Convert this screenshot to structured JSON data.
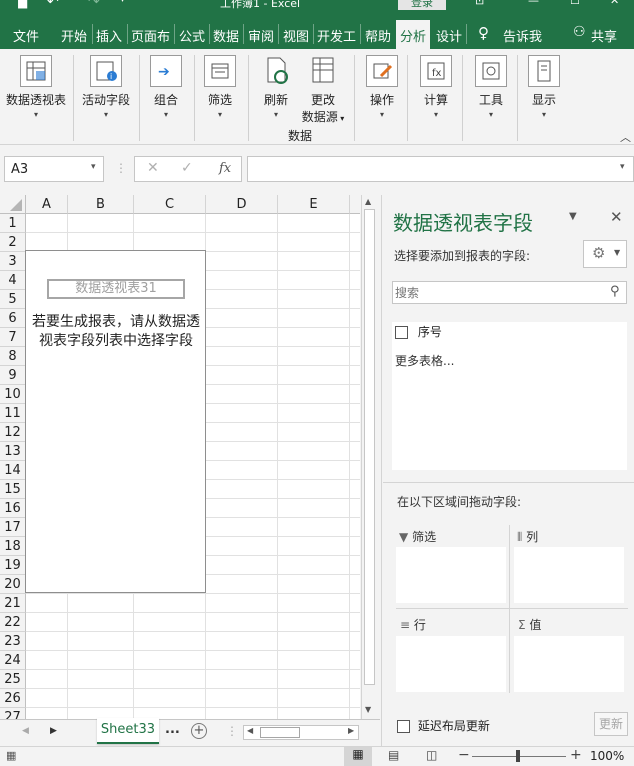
{
  "window": {
    "title": "工作簿1 - Excel",
    "login_label": "登录"
  },
  "menu": {
    "tabs": [
      "文件",
      "开始",
      "插入",
      "页面布",
      "公式",
      "数据",
      "审阅",
      "视图",
      "开发工",
      "帮助",
      "分析",
      "设计"
    ],
    "active_tab": "分析",
    "tell_me": "告诉我",
    "share": "共享"
  },
  "ribbon": {
    "buttons": {
      "pivot_table": "数据透视表",
      "active_field": "活动字段",
      "group": "组合",
      "filter": "筛选",
      "refresh": "刷新",
      "change_source_1": "更改",
      "change_source_2": "数据源",
      "actions": "操作",
      "calculations": "计算",
      "tools": "工具",
      "show": "显示"
    },
    "group_data_label": "数据"
  },
  "formula_bar": {
    "name_box": "A3",
    "fx_label": "fx",
    "formula": ""
  },
  "grid": {
    "columns": [
      "A",
      "B",
      "C",
      "D",
      "E"
    ],
    "rows": [
      "1",
      "2",
      "3",
      "4",
      "5",
      "6",
      "7",
      "8",
      "9",
      "10",
      "11",
      "12",
      "13",
      "14",
      "15",
      "16",
      "17",
      "18",
      "19",
      "20",
      "21",
      "22",
      "23",
      "24",
      "25",
      "26",
      "27"
    ]
  },
  "pivot_placeholder": {
    "name": "数据透视表31",
    "hint": "若要生成报表，请从数据透视表字段列表中选择字段"
  },
  "sheets": {
    "active": "Sheet33",
    "more": "..."
  },
  "status": {
    "zoom": "100%"
  },
  "pane": {
    "title": "数据透视表字段",
    "choose_label": "选择要添加到报表的字段:",
    "search_placeholder": "搜索",
    "fields": [
      {
        "name": "序号",
        "checked": false
      }
    ],
    "more_tables": "更多表格...",
    "drag_label": "在以下区域间拖动字段:",
    "areas": {
      "filter": "筛选",
      "columns": "列",
      "rows": "行",
      "values": "值"
    },
    "defer_label": "延迟布局更新",
    "update_button": "更新"
  }
}
